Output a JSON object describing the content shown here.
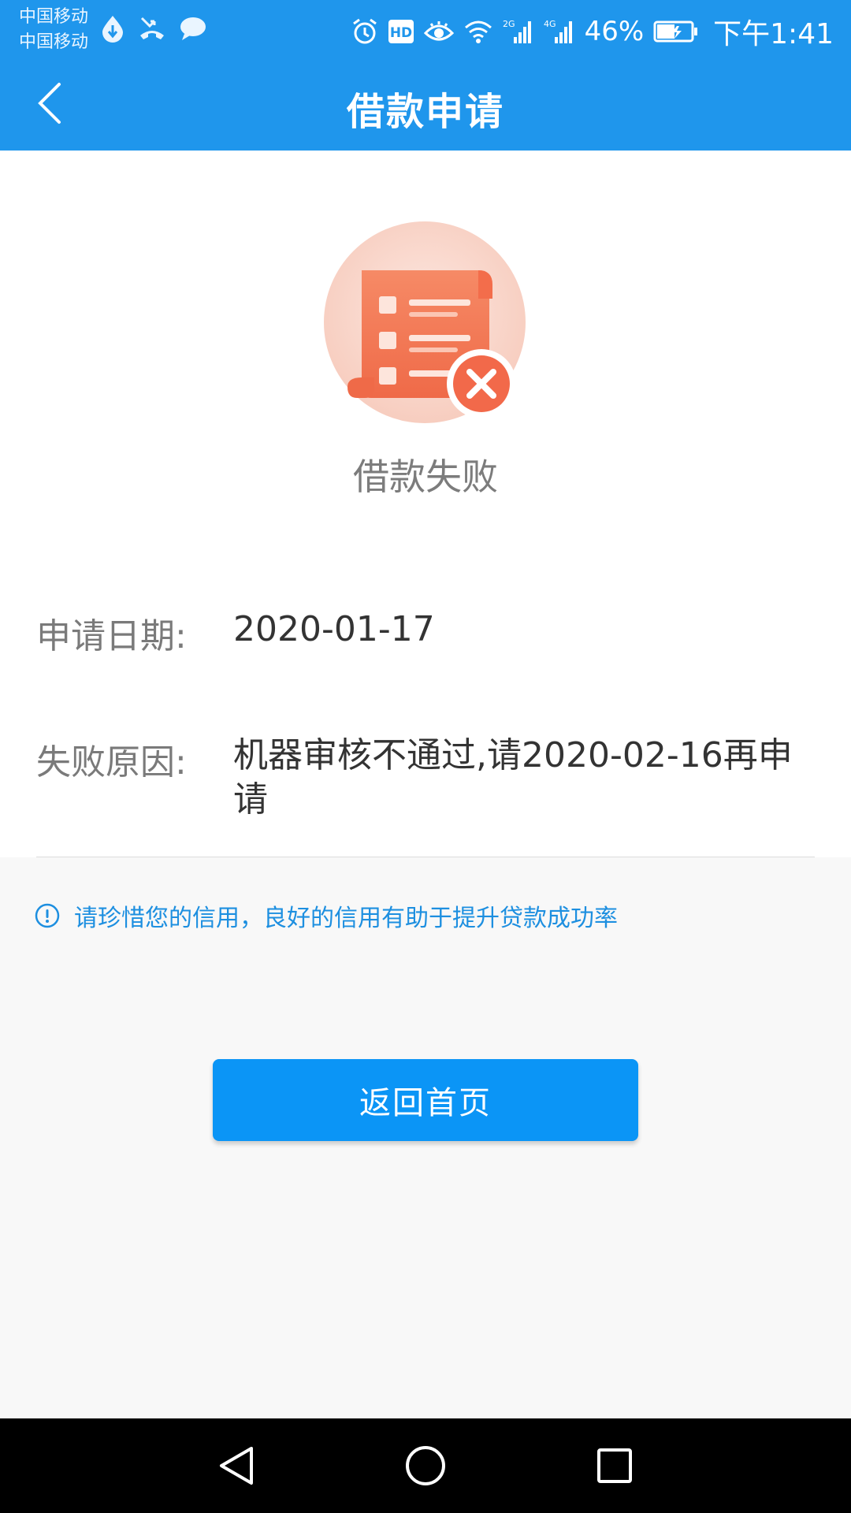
{
  "status_bar": {
    "carrier_1": "中国移动",
    "carrier_2": "中国移动",
    "battery_percent": "46%",
    "time": "下午1:41",
    "network_2g": "2G",
    "network_4g": "4G",
    "hd_badge": "HD",
    "icons_left": [
      "data-saver-icon",
      "missed-call-icon",
      "message-icon"
    ],
    "icons_right": [
      "alarm-icon",
      "hd-icon",
      "eye-comfort-icon",
      "wifi-icon",
      "signal-2g-icon",
      "signal-4g-icon",
      "battery-icon"
    ]
  },
  "header": {
    "title": "借款申请",
    "back_icon": "chevron-left-icon"
  },
  "result": {
    "icon": "document-failed-icon",
    "title": "借款失败"
  },
  "details": {
    "date_label": "申请日期:",
    "date_value": "2020-01-17",
    "reason_label": "失败原因:",
    "reason_value": "机器审核不通过,请2020-02-16再申请"
  },
  "notice": {
    "icon": "info-icon",
    "text": "请珍惜您的信用，良好的信用有助于提升贷款成功率"
  },
  "actions": {
    "home_button_label": "返回首页"
  },
  "nav_bar": {
    "back": "back-triangle-icon",
    "home": "home-circle-icon",
    "recents": "recents-square-icon"
  },
  "colors": {
    "primary": "#1f96ec",
    "button": "#0b95f6",
    "notice_text": "#1d8fe0",
    "error": "#f2694a"
  }
}
